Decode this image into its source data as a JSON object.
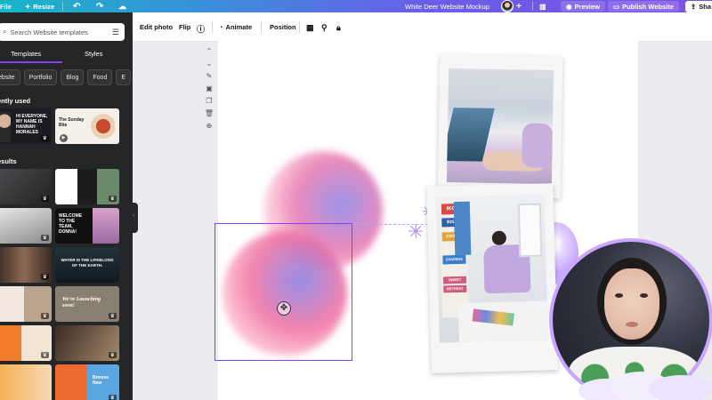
{
  "topbar": {
    "file": "File",
    "resize": "Resize",
    "doc_title": "White Deer Website Mockup",
    "plus": "+",
    "preview": "Preview",
    "publish": "Publish Website",
    "share": "Sha"
  },
  "sidebar": {
    "search_placeholder": "Search Website templates",
    "tabs": [
      "Templates",
      "Styles"
    ],
    "chips": [
      "ebsite",
      "Portfolio",
      "Blog",
      "Food",
      "E"
    ],
    "recently_used": "ently used",
    "results": "esults",
    "recent": [
      {
        "text": "HI EVERYONE, MY NAME IS HANNAH MORALES"
      },
      {
        "text": "The Sunday Bite"
      }
    ],
    "result_texts": {
      "t2": "WELCOME TO THE TEAM, DONNA!",
      "t3": "WATER IS THE LIFEBLOOD OF THE EARTH.",
      "t4": "We're Launching soon!",
      "t5": "Browse Now"
    }
  },
  "toolbar": {
    "edit_photo": "Edit photo",
    "flip": "Flip",
    "animate": "Animate",
    "position": "Position"
  },
  "canvas": {
    "poster_words": [
      "IKO",
      "BISM",
      "CHIPS",
      "SPAPERS",
      "SWEET",
      "RETREAT"
    ]
  },
  "colors": {
    "accent": "#8b3dff",
    "sidebar_bg": "#252627",
    "topbar_start": "#19b5c8",
    "topbar_end": "#7f4fe6"
  }
}
